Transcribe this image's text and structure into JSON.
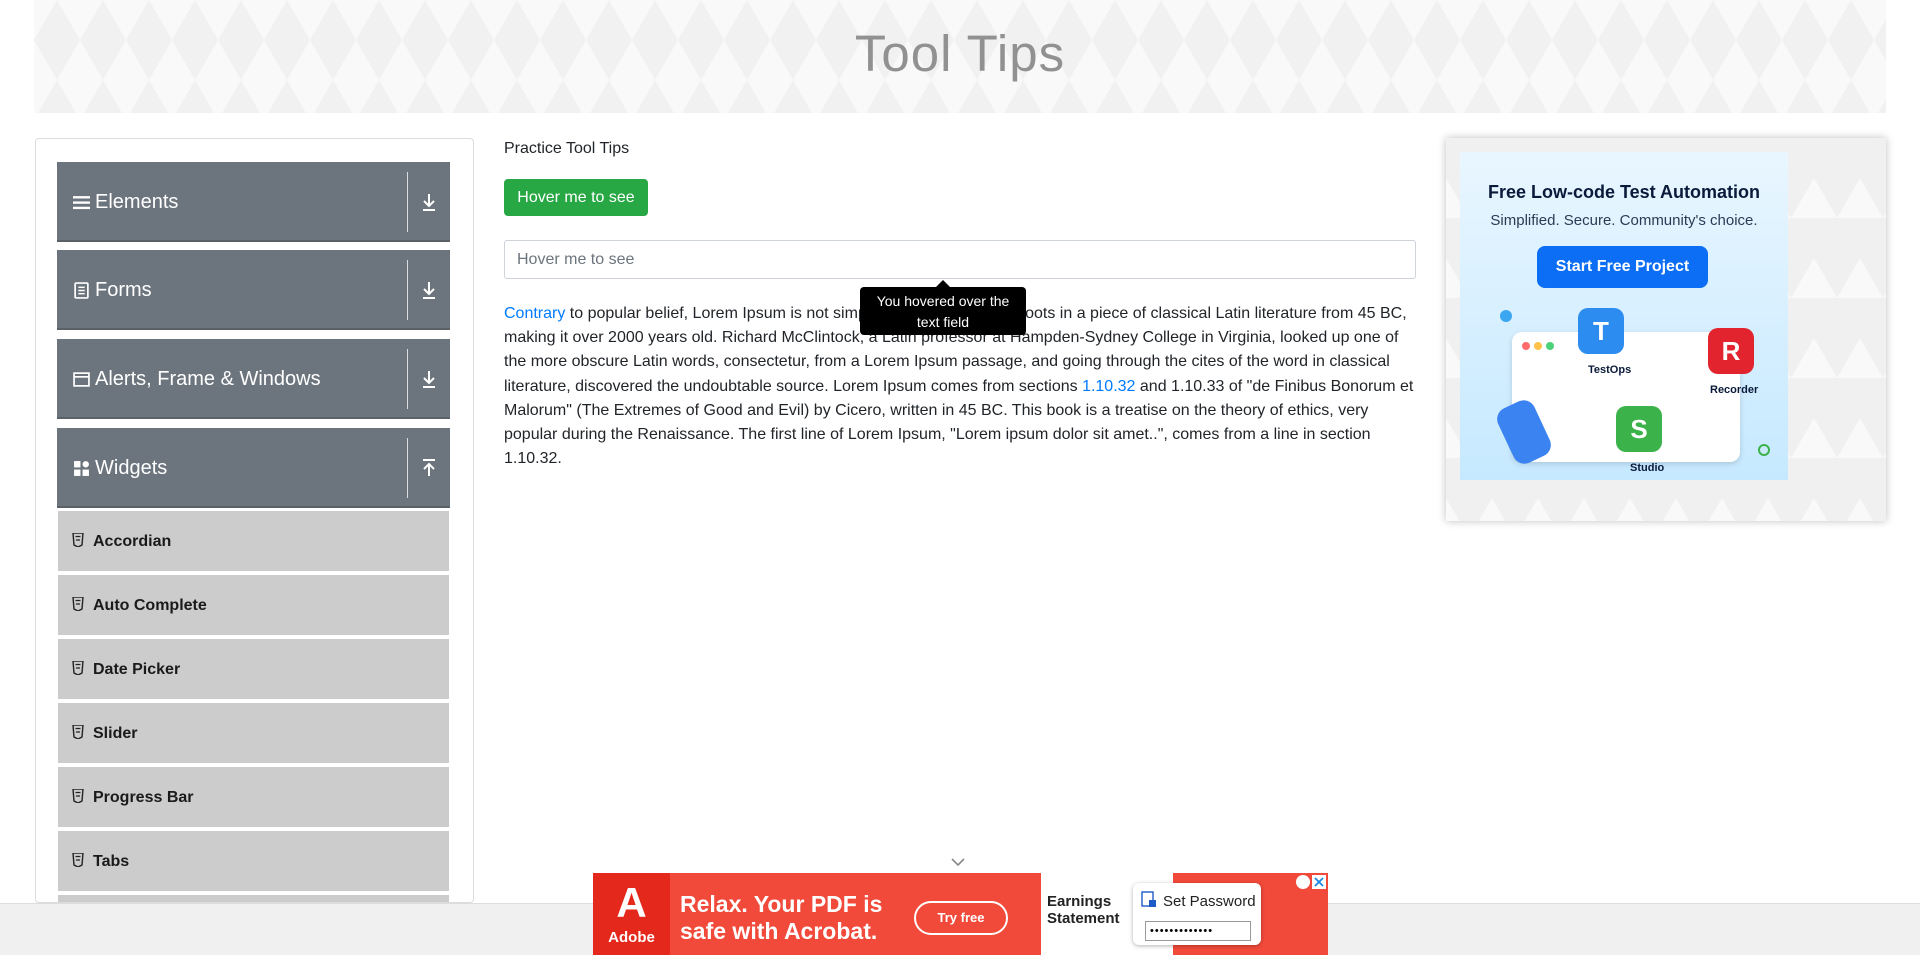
{
  "header": {
    "title": "Tool Tips"
  },
  "sidebar": {
    "groups": [
      {
        "label": "Elements",
        "icon": "list-icon",
        "expanded": false
      },
      {
        "label": "Forms",
        "icon": "form-icon",
        "expanded": false
      },
      {
        "label": "Alerts, Frame & Windows",
        "icon": "window-icon",
        "expanded": false
      },
      {
        "label": "Widgets",
        "icon": "grid-icon",
        "expanded": true
      }
    ],
    "widget_items": [
      "Accordian",
      "Auto Complete",
      "Date Picker",
      "Slider",
      "Progress Bar",
      "Tabs"
    ]
  },
  "main": {
    "practice_title": "Practice Tool Tips",
    "hover_button": "Hover me to see",
    "text_field_placeholder": "Hover me to see",
    "tooltip": "You hovered over the text field",
    "paragraph": {
      "link1": "Contrary",
      "text1": " to popular belief, Lorem Ipsum is not simply random text. It has roots in a piece of classical Latin literature from 45 BC, making it over 2000 years old. Richard McClintock, a Latin professor at Hampden-Sydney College in Virginia, looked up one of the more obscure Latin words, consectetur, from a Lorem Ipsum passage, and going through the cites of the word in classical literature, discovered the undoubtable source. Lorem Ipsum comes from sections ",
      "link2": "1.10.32",
      "text2": " and 1.10.33 of \"de Finibus Bonorum et Malorum\" (The Extremes of Good and Evil) by Cicero, written in 45 BC. This book is a treatise on the theory of ethics, very popular during the Renaissance. The first line of Lorem Ipsum, \"Lorem ipsum dolor sit amet..\", comes from a line in section 1.10.32."
    }
  },
  "side_ad": {
    "title": "Free Low-code Test Automation",
    "subtitle": "Simplified. Secure. Community's choice.",
    "button": "Start Free Project",
    "products": [
      "TestOps",
      "Recorder",
      "Studio"
    ]
  },
  "bottom_ad": {
    "brand": "Adobe",
    "headline_line1": "Relax. Your PDF is",
    "headline_line2": "safe with Acrobat.",
    "cta": "Try free",
    "doc_title_line1": "Earnings",
    "doc_title_line2": "Statement",
    "password_label": "Set Password",
    "password_mask": "•••••••••••••"
  },
  "colors": {
    "accent_green": "#28a745",
    "sidebar_group": "#6c757d",
    "link": "#007bff",
    "ad_button": "#0b6ef5"
  }
}
